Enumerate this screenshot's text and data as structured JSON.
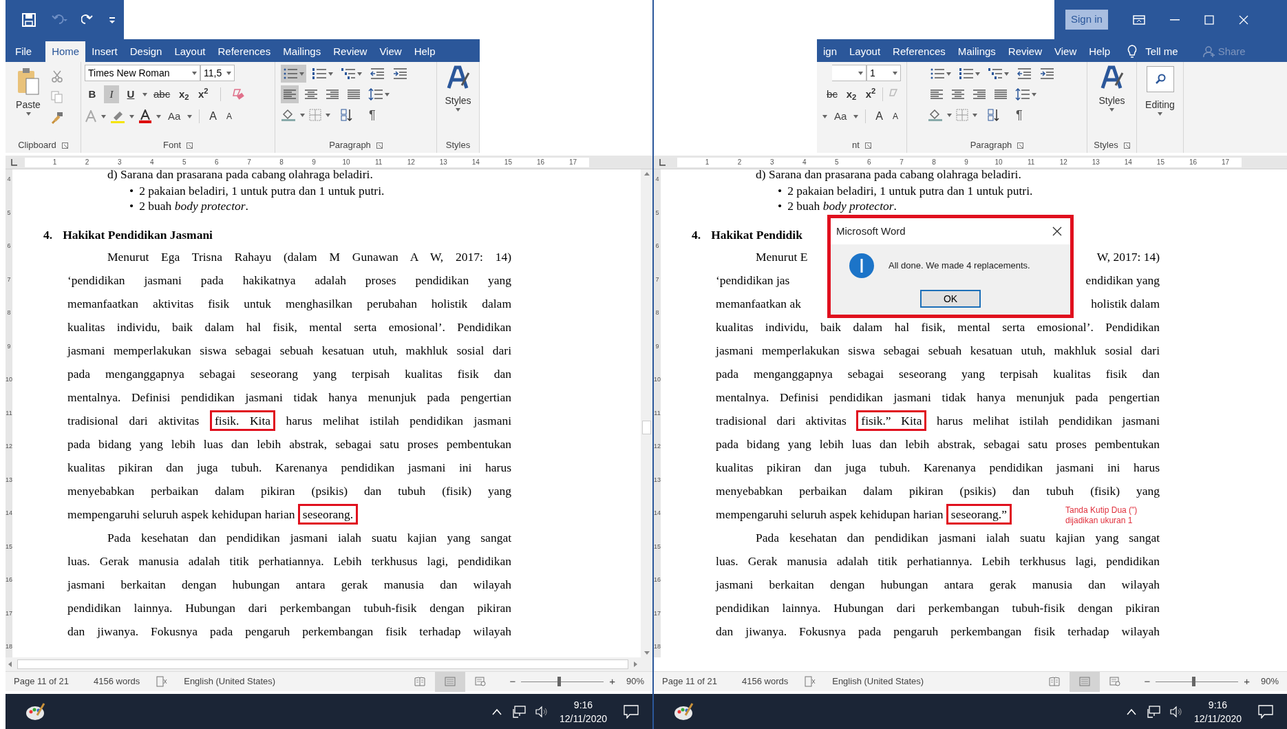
{
  "left_window": {
    "tabs": [
      {
        "label": "File",
        "selected": false
      },
      {
        "label": "Home",
        "selected": true
      },
      {
        "label": "Insert",
        "selected": false
      },
      {
        "label": "Design",
        "selected": false
      },
      {
        "label": "Layout",
        "selected": false
      },
      {
        "label": "References",
        "selected": false
      },
      {
        "label": "Mailings",
        "selected": false
      },
      {
        "label": "Review",
        "selected": false
      },
      {
        "label": "View",
        "selected": false
      },
      {
        "label": "Help",
        "selected": false
      }
    ],
    "ribbon": {
      "paste_label": "Paste",
      "font_name": "Times New Roman",
      "font_size": "11,5",
      "format_buttons": [
        {
          "kind": "bold",
          "label": "B",
          "pressed": false
        },
        {
          "kind": "italic",
          "label": "I",
          "pressed": true
        },
        {
          "kind": "underline",
          "label": "U",
          "pressed": false
        },
        {
          "kind": "strike",
          "label": "abc",
          "pressed": false
        },
        {
          "kind": "subscript",
          "label": "x$_{2}$",
          "pressed": false
        },
        {
          "kind": "superscript",
          "label": "x$^{2}$",
          "pressed": false
        }
      ],
      "case_button": "Aa",
      "grow_button": "A",
      "shrink_button": "A",
      "paragraph_buttons": [
        {
          "kind": "bullets",
          "pressed": true
        },
        {
          "kind": "numbering",
          "pressed": false
        },
        {
          "kind": "multilevel",
          "pressed": false
        },
        {
          "kind": "outdent",
          "pressed": false
        },
        {
          "kind": "indent",
          "pressed": false
        },
        {
          "kind": "align-left",
          "pressed": true
        },
        {
          "kind": "align-center",
          "pressed": false
        },
        {
          "kind": "align-right",
          "pressed": false
        },
        {
          "kind": "justify",
          "pressed": false
        },
        {
          "kind": "line-spacing",
          "pressed": false
        }
      ],
      "pilcrow": "¶",
      "styles_label": "Styles",
      "groups": [
        "Clipboard",
        "Font",
        "Paragraph",
        "Styles"
      ]
    },
    "ruler_numbers": [
      "1",
      "2",
      "3",
      "4",
      "5",
      "6",
      "7",
      "8",
      "9",
      "10",
      "11",
      "12",
      "13",
      "14",
      "15",
      "16",
      "17"
    ],
    "vertical_ruler_numbers": [
      "4",
      "5",
      "6",
      "7",
      "8",
      "9",
      "10",
      "11",
      "12",
      "13",
      "14",
      "15",
      "16",
      "17",
      "18"
    ],
    "document": [
      {
        "kind": "item",
        "text": "d) Sarana dan prasarana pada cabang olahraga beladiri."
      },
      {
        "kind": "bullet",
        "marker": "•",
        "text": "2 pakaian beladiri, 1 untuk putra dan 1 untuk putri."
      },
      {
        "kind": "bullet",
        "marker": "•",
        "text": "2 buah *body protector*."
      },
      {
        "kind": "heading",
        "number": "4.",
        "text": "Hakikat Pendidikan Jasmani"
      },
      {
        "kind": "body",
        "indent": true,
        "justify": true,
        "segments": [
          {
            "text": "Menurut Ega Trisna Rahayu (dalam M Gunawan A W, 2017: 14)",
            "boxed": false
          }
        ]
      },
      {
        "kind": "body",
        "indent": false,
        "justify": true,
        "segments": [
          {
            "text": "‘pendidikan jasmani pada hakikatnya adalah proses pendidikan yang",
            "boxed": false
          }
        ]
      },
      {
        "kind": "body",
        "indent": false,
        "justify": true,
        "segments": [
          {
            "text": "memanfaatkan aktivitas fisik untuk menghasilkan perubahan holistik dalam",
            "boxed": false
          }
        ]
      },
      {
        "kind": "body",
        "indent": false,
        "justify": true,
        "segments": [
          {
            "text": "kualitas individu, baik dalam hal fisik, mental serta emosional’. Pendidikan",
            "boxed": false
          }
        ]
      },
      {
        "kind": "body",
        "indent": false,
        "justify": true,
        "segments": [
          {
            "text": "jasmani memperlakukan siswa sebagai sebuah kesatuan utuh, makhluk sosial dari",
            "boxed": false
          }
        ]
      },
      {
        "kind": "body",
        "indent": false,
        "justify": true,
        "segments": [
          {
            "text": "pada menganggapnya sebagai seseorang yang terpisah kualitas fisik dan",
            "boxed": false
          }
        ]
      },
      {
        "kind": "body",
        "indent": false,
        "justify": true,
        "segments": [
          {
            "text": "mentalnya. Definisi pendidikan jasmani tidak hanya menunjuk pada pengertian",
            "boxed": false
          }
        ]
      },
      {
        "kind": "body",
        "indent": false,
        "justify": true,
        "segments": [
          {
            "text": "tradisional dari aktivitas ",
            "boxed": false
          },
          {
            "text": "fisik. Kita",
            "boxed": true
          },
          {
            "text": " harus melihat istilah pendidikan jasmani",
            "boxed": false
          }
        ]
      },
      {
        "kind": "body",
        "indent": false,
        "justify": true,
        "segments": [
          {
            "text": "pada bidang yang lebih luas dan lebih abstrak, sebagai satu proses pembentukan",
            "boxed": false
          }
        ]
      },
      {
        "kind": "body",
        "indent": false,
        "justify": true,
        "segments": [
          {
            "text": "kualitas pikiran dan juga tubuh. Karenanya pendidikan jasmani ini harus",
            "boxed": false
          }
        ]
      },
      {
        "kind": "body",
        "indent": false,
        "justify": true,
        "segments": [
          {
            "text": "menyebabkan perbaikan dalam pikiran (psikis) dan tubuh (fisik) yang",
            "boxed": false
          }
        ]
      },
      {
        "kind": "body",
        "indent": false,
        "justify": false,
        "segments": [
          {
            "text": "mempengaruhi seluruh aspek kehidupan harian ",
            "boxed": false
          },
          {
            "text": "seseorang.",
            "boxed": true
          }
        ]
      },
      {
        "kind": "body",
        "indent": true,
        "justify": true,
        "segments": [
          {
            "text": "Pada kesehatan dan pendidikan jasmani ialah suatu kajian yang sangat",
            "boxed": false
          }
        ]
      },
      {
        "kind": "body",
        "indent": false,
        "justify": true,
        "segments": [
          {
            "text": "luas. Gerak manusia adalah titik perhatiannya. Lebih terkhusus lagi, pendidikan",
            "boxed": false
          }
        ]
      },
      {
        "kind": "body",
        "indent": false,
        "justify": true,
        "segments": [
          {
            "text": "jasmani berkaitan dengan hubungan antara gerak manusia dan wilayah",
            "boxed": false
          }
        ]
      },
      {
        "kind": "body",
        "indent": false,
        "justify": true,
        "segments": [
          {
            "text": "pendidikan lainnya. Hubungan dari perkembangan tubuh-fisik dengan pikiran",
            "boxed": false
          }
        ]
      },
      {
        "kind": "body",
        "indent": false,
        "justify": true,
        "segments": [
          {
            "text": "dan jiwanya. Fokusnya pada pengaruh perkembangan fisik terhadap wilayah",
            "boxed": false
          }
        ]
      }
    ],
    "status_bar": {
      "page": "Page 11 of 21",
      "words": "4156 words",
      "language": "English (United States)",
      "views": [
        {
          "kind": "read",
          "selected": false
        },
        {
          "kind": "print",
          "selected": true
        },
        {
          "kind": "web",
          "selected": false
        }
      ],
      "zoom_out": "−",
      "zoom_in": "+",
      "zoom_level": {
        "level": 0.46
      },
      "zoom": "90%"
    },
    "taskbar": {
      "time": "9:16",
      "date": "12/11/2020"
    }
  },
  "right_window": {
    "sign_in": "Sign in",
    "tabs": [
      {
        "label": "ign",
        "selected": false
      },
      {
        "label": "Layout",
        "selected": false
      },
      {
        "label": "References",
        "selected": false
      },
      {
        "label": "Mailings",
        "selected": false
      },
      {
        "label": "Review",
        "selected": false
      },
      {
        "label": "View",
        "selected": false
      },
      {
        "label": "Help",
        "selected": false
      }
    ],
    "tell_me": "Tell me",
    "share": "Share",
    "ribbon": {
      "font_size": "1",
      "format_buttons": [
        {
          "kind": "strike",
          "label": "bc",
          "pressed": false
        },
        {
          "kind": "subscript",
          "label": "x$_{2}$",
          "pressed": false
        },
        {
          "kind": "superscript",
          "label": "x$^{2}$",
          "pressed": false
        }
      ],
      "case_button": "Aa",
      "grow_button": "A",
      "shrink_button": "A",
      "paragraph_buttons": [
        {
          "kind": "bullets",
          "pressed": false
        },
        {
          "kind": "numbering",
          "pressed": false
        },
        {
          "kind": "multilevel",
          "pressed": false
        },
        {
          "kind": "outdent",
          "pressed": false
        },
        {
          "kind": "indent",
          "pressed": false
        },
        {
          "kind": "align-left",
          "pressed": false
        },
        {
          "kind": "align-center",
          "pressed": false
        },
        {
          "kind": "align-right",
          "pressed": false
        },
        {
          "kind": "justify",
          "pressed": false
        },
        {
          "kind": "line-spacing",
          "pressed": false
        }
      ],
      "pilcrow": "¶",
      "styles_label": "Styles",
      "editing_label": "Editing",
      "groups": [
        "nt",
        "Paragraph",
        "Styles"
      ]
    },
    "ruler_numbers": [
      "1",
      "2",
      "3",
      "4",
      "5",
      "6",
      "7",
      "8",
      "9",
      "10",
      "11",
      "12",
      "13",
      "14",
      "15",
      "16",
      "17"
    ],
    "vertical_ruler_numbers": [
      "4",
      "5",
      "6",
      "7",
      "8",
      "9",
      "10",
      "11",
      "12",
      "13",
      "14",
      "15",
      "16",
      "17",
      "18"
    ],
    "document": [
      {
        "kind": "item",
        "text": "d) Sarana dan prasarana pada cabang olahraga beladiri."
      },
      {
        "kind": "bullet",
        "marker": "•",
        "text": "2 pakaian beladiri, 1 untuk putra dan 1 untuk putri."
      },
      {
        "kind": "bullet",
        "marker": "•",
        "text": "2 buah *body protector*."
      },
      {
        "kind": "heading",
        "number": "4.",
        "text": "Hakikat Pendidik"
      },
      {
        "kind": "split",
        "indent": true,
        "left": "Menurut E",
        "right": "W, 2017: 14)"
      },
      {
        "kind": "split",
        "indent": false,
        "left": "‘pendidikan jas",
        "right": "endidikan yang"
      },
      {
        "kind": "split",
        "indent": false,
        "left": "memanfaatkan ak",
        "right": "holistik dalam"
      },
      {
        "kind": "body",
        "indent": false,
        "justify": true,
        "segments": [
          {
            "text": "kualitas individu, baik dalam hal fisik, mental serta emosional’. Pendidikan",
            "boxed": false
          }
        ]
      },
      {
        "kind": "body",
        "indent": false,
        "justify": true,
        "segments": [
          {
            "text": "jasmani memperlakukan siswa sebagai sebuah kesatuan utuh, makhluk sosial dari",
            "boxed": false
          }
        ]
      },
      {
        "kind": "body",
        "indent": false,
        "justify": true,
        "segments": [
          {
            "text": "pada menganggapnya sebagai seseorang yang terpisah kualitas fisik dan",
            "boxed": false
          }
        ]
      },
      {
        "kind": "body",
        "indent": false,
        "justify": true,
        "segments": [
          {
            "text": "mentalnya. Definisi pendidikan jasmani tidak hanya menunjuk pada pengertian",
            "boxed": false
          }
        ]
      },
      {
        "kind": "body",
        "indent": false,
        "justify": true,
        "segments": [
          {
            "text": "tradisional dari aktivitas ",
            "boxed": false
          },
          {
            "text": "fisik.” Kita",
            "boxed": true
          },
          {
            "text": " harus melihat istilah pendidikan jasmani",
            "boxed": false
          }
        ]
      },
      {
        "kind": "body",
        "indent": false,
        "justify": true,
        "segments": [
          {
            "text": "pada bidang yang lebih luas dan lebih abstrak, sebagai satu proses pembentukan",
            "boxed": false
          }
        ]
      },
      {
        "kind": "body",
        "indent": false,
        "justify": true,
        "segments": [
          {
            "text": "kualitas pikiran dan juga tubuh. Karenanya pendidikan jasmani ini harus",
            "boxed": false
          }
        ]
      },
      {
        "kind": "body",
        "indent": false,
        "justify": true,
        "segments": [
          {
            "text": "menyebabkan perbaikan dalam pikiran (psikis) dan tubuh (fisik) yang",
            "boxed": false
          }
        ]
      },
      {
        "kind": "body",
        "indent": false,
        "justify": false,
        "segments": [
          {
            "text": "mempengaruhi seluruh aspek kehidupan harian ",
            "boxed": false
          },
          {
            "text": "seseorang.”",
            "boxed": true
          }
        ]
      },
      {
        "kind": "body",
        "indent": true,
        "justify": true,
        "segments": [
          {
            "text": "Pada kesehatan dan pendidikan jasmani ialah suatu kajian yang sangat",
            "boxed": false
          }
        ]
      },
      {
        "kind": "body",
        "indent": false,
        "justify": true,
        "segments": [
          {
            "text": "luas. Gerak manusia adalah titik perhatiannya. Lebih terkhusus lagi, pendidikan",
            "boxed": false
          }
        ]
      },
      {
        "kind": "body",
        "indent": false,
        "justify": true,
        "segments": [
          {
            "text": "jasmani berkaitan dengan hubungan antara gerak manusia dan wilayah",
            "boxed": false
          }
        ]
      },
      {
        "kind": "body",
        "indent": false,
        "justify": true,
        "segments": [
          {
            "text": "pendidikan lainnya. Hubungan dari perkembangan tubuh-fisik dengan pikiran",
            "boxed": false
          }
        ]
      },
      {
        "kind": "body",
        "indent": false,
        "justify": true,
        "segments": [
          {
            "text": "dan jiwanya. Fokusnya pada pengaruh perkembangan fisik terhadap wilayah",
            "boxed": false
          }
        ]
      }
    ],
    "dialog": {
      "title": "Microsoft Word",
      "message": "All done. We made 4 replacements.",
      "ok": "OK"
    },
    "annotation": [
      "Tanda Kutip Dua (\")",
      "dijadikan ukuran 1"
    ],
    "status_bar": {
      "page": "Page 11 of 21",
      "words": "4156 words",
      "language": "English (United States)",
      "views": [
        {
          "kind": "read",
          "selected": false
        },
        {
          "kind": "print",
          "selected": true
        },
        {
          "kind": "web",
          "selected": false
        }
      ],
      "zoom_out": "−",
      "zoom_in": "+",
      "zoom_level": {
        "level": 0.46
      },
      "zoom": "90%"
    },
    "taskbar": {
      "time": "9:16",
      "date": "12/11/2020"
    }
  }
}
